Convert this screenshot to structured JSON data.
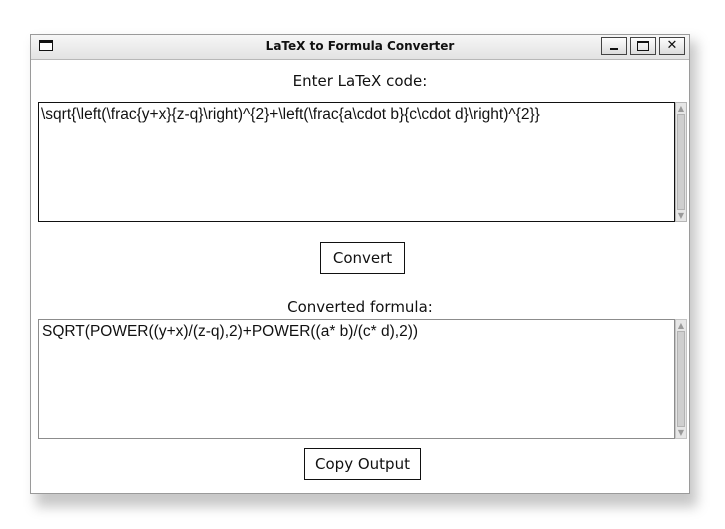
{
  "window": {
    "title": "LaTeX to Formula Converter",
    "close_glyph": "✕"
  },
  "icons": {
    "window": "window-icon",
    "minimize": "minimize-icon",
    "maximize": "maximize-icon",
    "close": "close-icon",
    "scroll_up": "scroll-up-arrow-icon",
    "scroll_down": "scroll-down-arrow-icon"
  },
  "glyphs": {
    "up": "▲",
    "down": "▼"
  },
  "input": {
    "label": "Enter LaTeX code:",
    "value": "\\sqrt{\\left(\\frac{y+x}{z-q}\\right)^{2}+\\left(\\frac{a\\cdot b}{c\\cdot d}\\right)^{2}}"
  },
  "convert_button": {
    "label": "Convert"
  },
  "output": {
    "label": "Converted formula:",
    "value": "SQRT(POWER((y+x)/(z-q),2)+POWER((a* b)/(c* d),2))"
  },
  "copy_button": {
    "label": "Copy Output"
  }
}
